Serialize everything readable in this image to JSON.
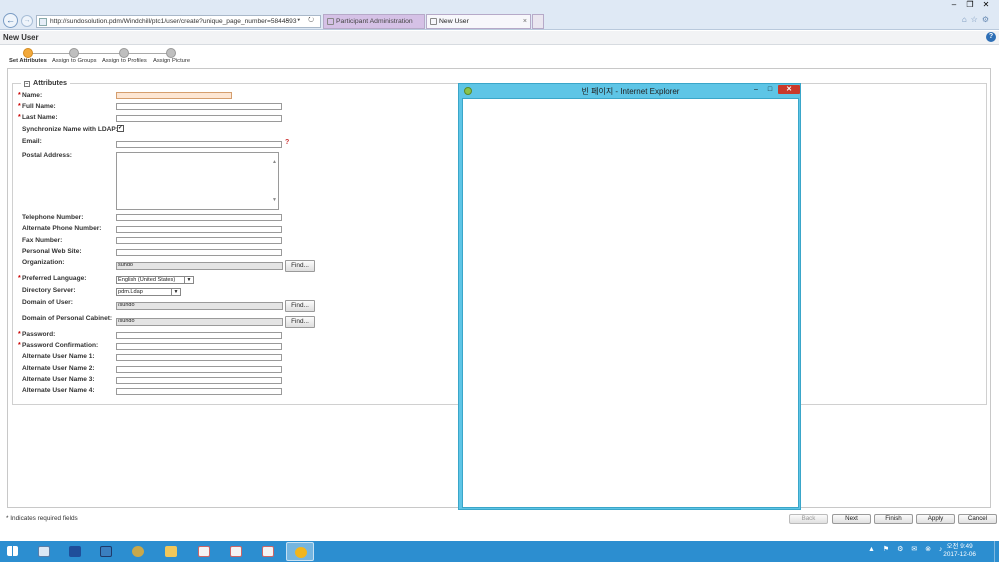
{
  "browser": {
    "url": "http://sundosolution.pdm/Windchill/ptc1/user/create?unique_page_number=5844593",
    "url_icons": "⌕ ▾ ↻",
    "tabs": [
      {
        "label": "Participant Administration"
      },
      {
        "label": "New User"
      }
    ],
    "tab_close": "×",
    "toolbar_icons": "⌂☆⚙",
    "window_controls": {
      "minimize": "‒",
      "restore": "❐",
      "close": "✕"
    }
  },
  "page": {
    "title": "New User",
    "help": "?"
  },
  "wizard": {
    "steps": [
      {
        "label": "Set Attributes",
        "active": true
      },
      {
        "label": "Assign to Groups",
        "active": false
      },
      {
        "label": "Assign to Profiles",
        "active": false
      },
      {
        "label": "Assign Picture",
        "active": false
      }
    ]
  },
  "form": {
    "section_title": "Attributes",
    "section_toggle": "−",
    "required_marker": "*",
    "fields": {
      "name": {
        "label": "Name:",
        "value": ""
      },
      "full_name": {
        "label": "Full Name:",
        "value": ""
      },
      "last_name": {
        "label": "Last Name:",
        "value": ""
      },
      "sync_ldap": {
        "label": "Synchronize Name with LDAP:",
        "checked": true,
        "mark": "✓"
      },
      "email": {
        "label": "Email:",
        "value": "",
        "help": "?"
      },
      "postal": {
        "label": "Postal Address:",
        "value": ""
      },
      "telephone": {
        "label": "Telephone Number:",
        "value": ""
      },
      "alt_phone": {
        "label": "Alternate Phone Number:",
        "value": ""
      },
      "fax": {
        "label": "Fax Number:",
        "value": ""
      },
      "website": {
        "label": "Personal Web Site:",
        "value": ""
      },
      "organization": {
        "label": "Organization:",
        "value": "sundo"
      },
      "language": {
        "label": "Preferred Language:",
        "value": "English (United States)"
      },
      "directory": {
        "label": "Directory Server:",
        "value": "pdm.Ldap"
      },
      "domain": {
        "label": "Domain of User:",
        "value": "/sundo"
      },
      "cabinet_domain": {
        "label": "Domain of Personal Cabinet:",
        "value": "/sundo"
      },
      "password": {
        "label": "Password:",
        "value": ""
      },
      "password_confirm": {
        "label": "Password Confirmation:",
        "value": ""
      },
      "alt_name_1": {
        "label": "Alternate User Name 1:",
        "value": ""
      },
      "alt_name_2": {
        "label": "Alternate User Name 2:",
        "value": ""
      },
      "alt_name_3": {
        "label": "Alternate User Name 3:",
        "value": ""
      },
      "alt_name_4": {
        "label": "Alternate User Name 4:",
        "value": ""
      }
    },
    "find_label": "Find..."
  },
  "popup": {
    "title": "빈 페이지 - Internet Explorer",
    "minimize": "‒",
    "maximize": "□",
    "close": "✕"
  },
  "footer": {
    "required_note": "* Indicates required fields",
    "buttons": {
      "back": "Back",
      "next": "Next",
      "finish": "Finish",
      "apply": "Apply",
      "cancel": "Cancel"
    }
  },
  "taskbar": {
    "tray_icons": "▲ ⚑ ⚙ ✉ ⊗ ♪",
    "time": "오전 9:49",
    "date": "2017-12-06"
  },
  "colors": {
    "popup_frame": "#5ec5e6",
    "taskbar": "#2c8ed0",
    "required": "#cc0000",
    "active_step": "#f2a93b"
  }
}
